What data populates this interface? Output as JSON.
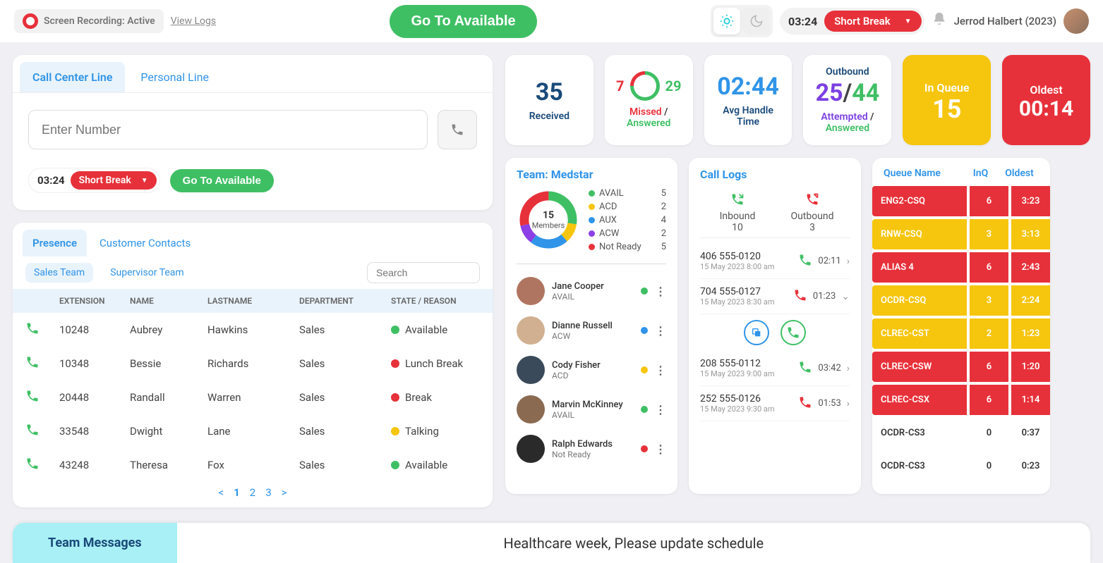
{
  "header": {
    "recording": "Screen Recording: Active",
    "view_logs": "View Logs",
    "go_available": "Go To Available",
    "status_time": "03:24",
    "status_label": "Short Break",
    "user_name": "Jerrod Halbert (2023)"
  },
  "dialer": {
    "tab_call_center": "Call Center Line",
    "tab_personal": "Personal Line",
    "placeholder": "Enter Number",
    "status_time": "03:24",
    "status_label": "Short Break",
    "go_available": "Go To Available"
  },
  "presence": {
    "tab_presence": "Presence",
    "tab_contacts": "Customer Contacts",
    "team_sales": "Sales Team",
    "team_supervisor": "Supervisor Team",
    "search_placeholder": "Search",
    "headers": {
      "ext": "EXTENSION",
      "name": "NAME",
      "last": "LASTNAME",
      "dept": "DEPARTMENT",
      "state": "STATE / REASON"
    },
    "rows": [
      {
        "ext": "10248",
        "name": "Aubrey",
        "last": "Hawkins",
        "dept": "Sales",
        "state": "Available",
        "color": "#3FBF64"
      },
      {
        "ext": "10348",
        "name": "Bessie",
        "last": "Richards",
        "dept": "Sales",
        "state": "Lunch Break",
        "color": "#E7313A"
      },
      {
        "ext": "20448",
        "name": "Randall",
        "last": "Warren",
        "dept": "Sales",
        "state": "Break",
        "color": "#E7313A"
      },
      {
        "ext": "33548",
        "name": "Dwight",
        "last": "Lane",
        "dept": "Sales",
        "state": "Talking",
        "color": "#F6C50E"
      },
      {
        "ext": "43248",
        "name": "Theresa",
        "last": "Fox",
        "dept": "Sales",
        "state": "Available",
        "color": "#3FBF64"
      }
    ],
    "pages": [
      "1",
      "2",
      "3"
    ]
  },
  "metrics": {
    "received_val": "35",
    "received_label": "Received",
    "missed_val": "7",
    "answered_val": "29",
    "missed_label": "Missed",
    "answered_label": "Answered",
    "aht_val": "02:44",
    "aht_label1": "Avg Handle",
    "aht_label2": "Time",
    "attempted_val": "25",
    "out_answered_val": "44",
    "outbound_label": "Outbound",
    "attempted_label": "Attempted",
    "out_answered_label": "Answered",
    "inq_label": "In Queue",
    "inq_val": "15",
    "oldest_label": "Oldest",
    "oldest_val": "00:14"
  },
  "team": {
    "title": "Team: Medstar",
    "members_count": "15",
    "members_label": "Members",
    "legend": [
      {
        "name": "AVAIL",
        "val": "5",
        "color": "#3FBF64"
      },
      {
        "name": "ACD",
        "val": "2",
        "color": "#F6C50E"
      },
      {
        "name": "AUX",
        "val": "4",
        "color": "#3094E8"
      },
      {
        "name": "ACW",
        "val": "2",
        "color": "#8B3FE4"
      },
      {
        "name": "Not Ready",
        "val": "5",
        "color": "#E7313A"
      }
    ],
    "members": [
      {
        "name": "Jane Cooper",
        "state": "AVAIL",
        "color": "#3FBF64",
        "av": "#b07560"
      },
      {
        "name": "Dianne Russell",
        "state": "ACW",
        "color": "#3094E8",
        "av": "#d0b090"
      },
      {
        "name": "Cody Fisher",
        "state": "ACD",
        "color": "#F6C50E",
        "av": "#3a4a5a"
      },
      {
        "name": "Marvin McKinney",
        "state": "AVAIL",
        "color": "#3FBF64",
        "av": "#8a6a50"
      },
      {
        "name": "Ralph Edwards",
        "state": "Not Ready",
        "color": "#E7313A",
        "av": "#2a2a2a"
      }
    ]
  },
  "call_logs": {
    "title": "Call Logs",
    "inbound_label": "Inbound",
    "inbound_val": "10",
    "outbound_label": "Outbound",
    "outbound_val": "3",
    "rows": [
      {
        "num": "406 555-0120",
        "date": "15 May 2023 8:00 am",
        "dur": "02:11",
        "dir": "in",
        "expanded": false
      },
      {
        "num": "704 555-0127",
        "date": "15 May 2023 8:30 am",
        "dur": "01:23",
        "dir": "out",
        "expanded": true
      },
      {
        "num": "208 555-0112",
        "date": "15 May 2023 9:00 am",
        "dur": "03:42",
        "dir": "in",
        "expanded": false
      },
      {
        "num": "252 555-0126",
        "date": "15 May 2023 9:30 am",
        "dur": "01:53",
        "dir": "out",
        "expanded": false
      }
    ]
  },
  "queue": {
    "h_name": "Queue Name",
    "h_inq": "InQ",
    "h_oldest": "Oldest",
    "rows": [
      {
        "name": "ENG2-CSQ",
        "inq": "6",
        "oldest": "3:23",
        "sev": "red"
      },
      {
        "name": "RNW-CSQ",
        "inq": "3",
        "oldest": "3:13",
        "sev": "yellow"
      },
      {
        "name": "ALIAS 4",
        "inq": "6",
        "oldest": "2:43",
        "sev": "red"
      },
      {
        "name": "OCDR-CSQ",
        "inq": "3",
        "oldest": "2:24",
        "sev": "yellow"
      },
      {
        "name": "CLREC-CST",
        "inq": "2",
        "oldest": "1:23",
        "sev": "yellow"
      },
      {
        "name": "CLREC-CSW",
        "inq": "6",
        "oldest": "1:20",
        "sev": "red"
      },
      {
        "name": "CLREC-CSX",
        "inq": "6",
        "oldest": "1:14",
        "sev": "red"
      },
      {
        "name": "OCDR-CS3",
        "inq": "0",
        "oldest": "0:37",
        "sev": "plain"
      },
      {
        "name": "OCDR-CS3",
        "inq": "0",
        "oldest": "0:23",
        "sev": "plain"
      }
    ]
  },
  "footer": {
    "team_messages": "Team Messages",
    "ticker": "Healthcare week, Please update schedule"
  }
}
